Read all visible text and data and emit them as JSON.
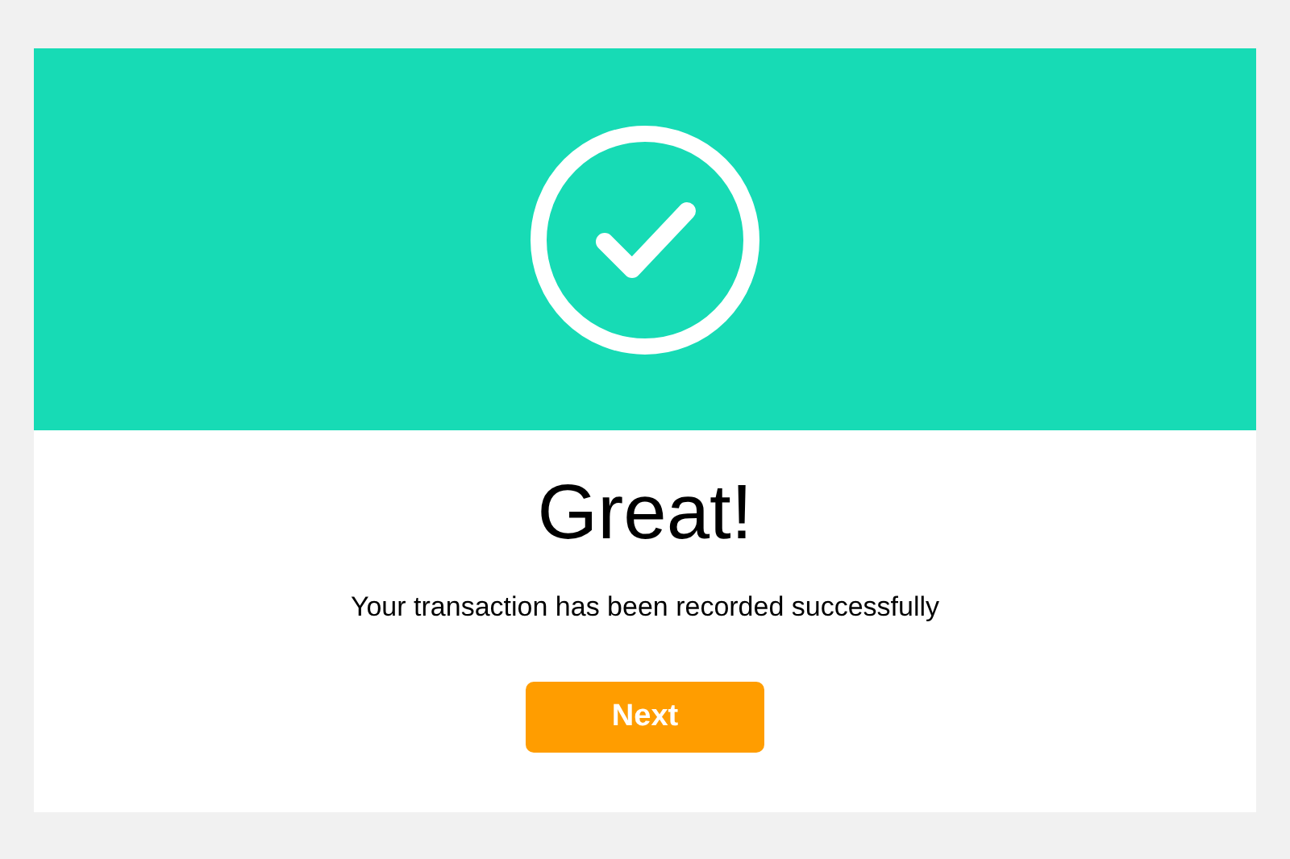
{
  "dialog": {
    "title": "Great!",
    "message": "Your transaction has been recorded successfully",
    "button": "Next"
  }
}
